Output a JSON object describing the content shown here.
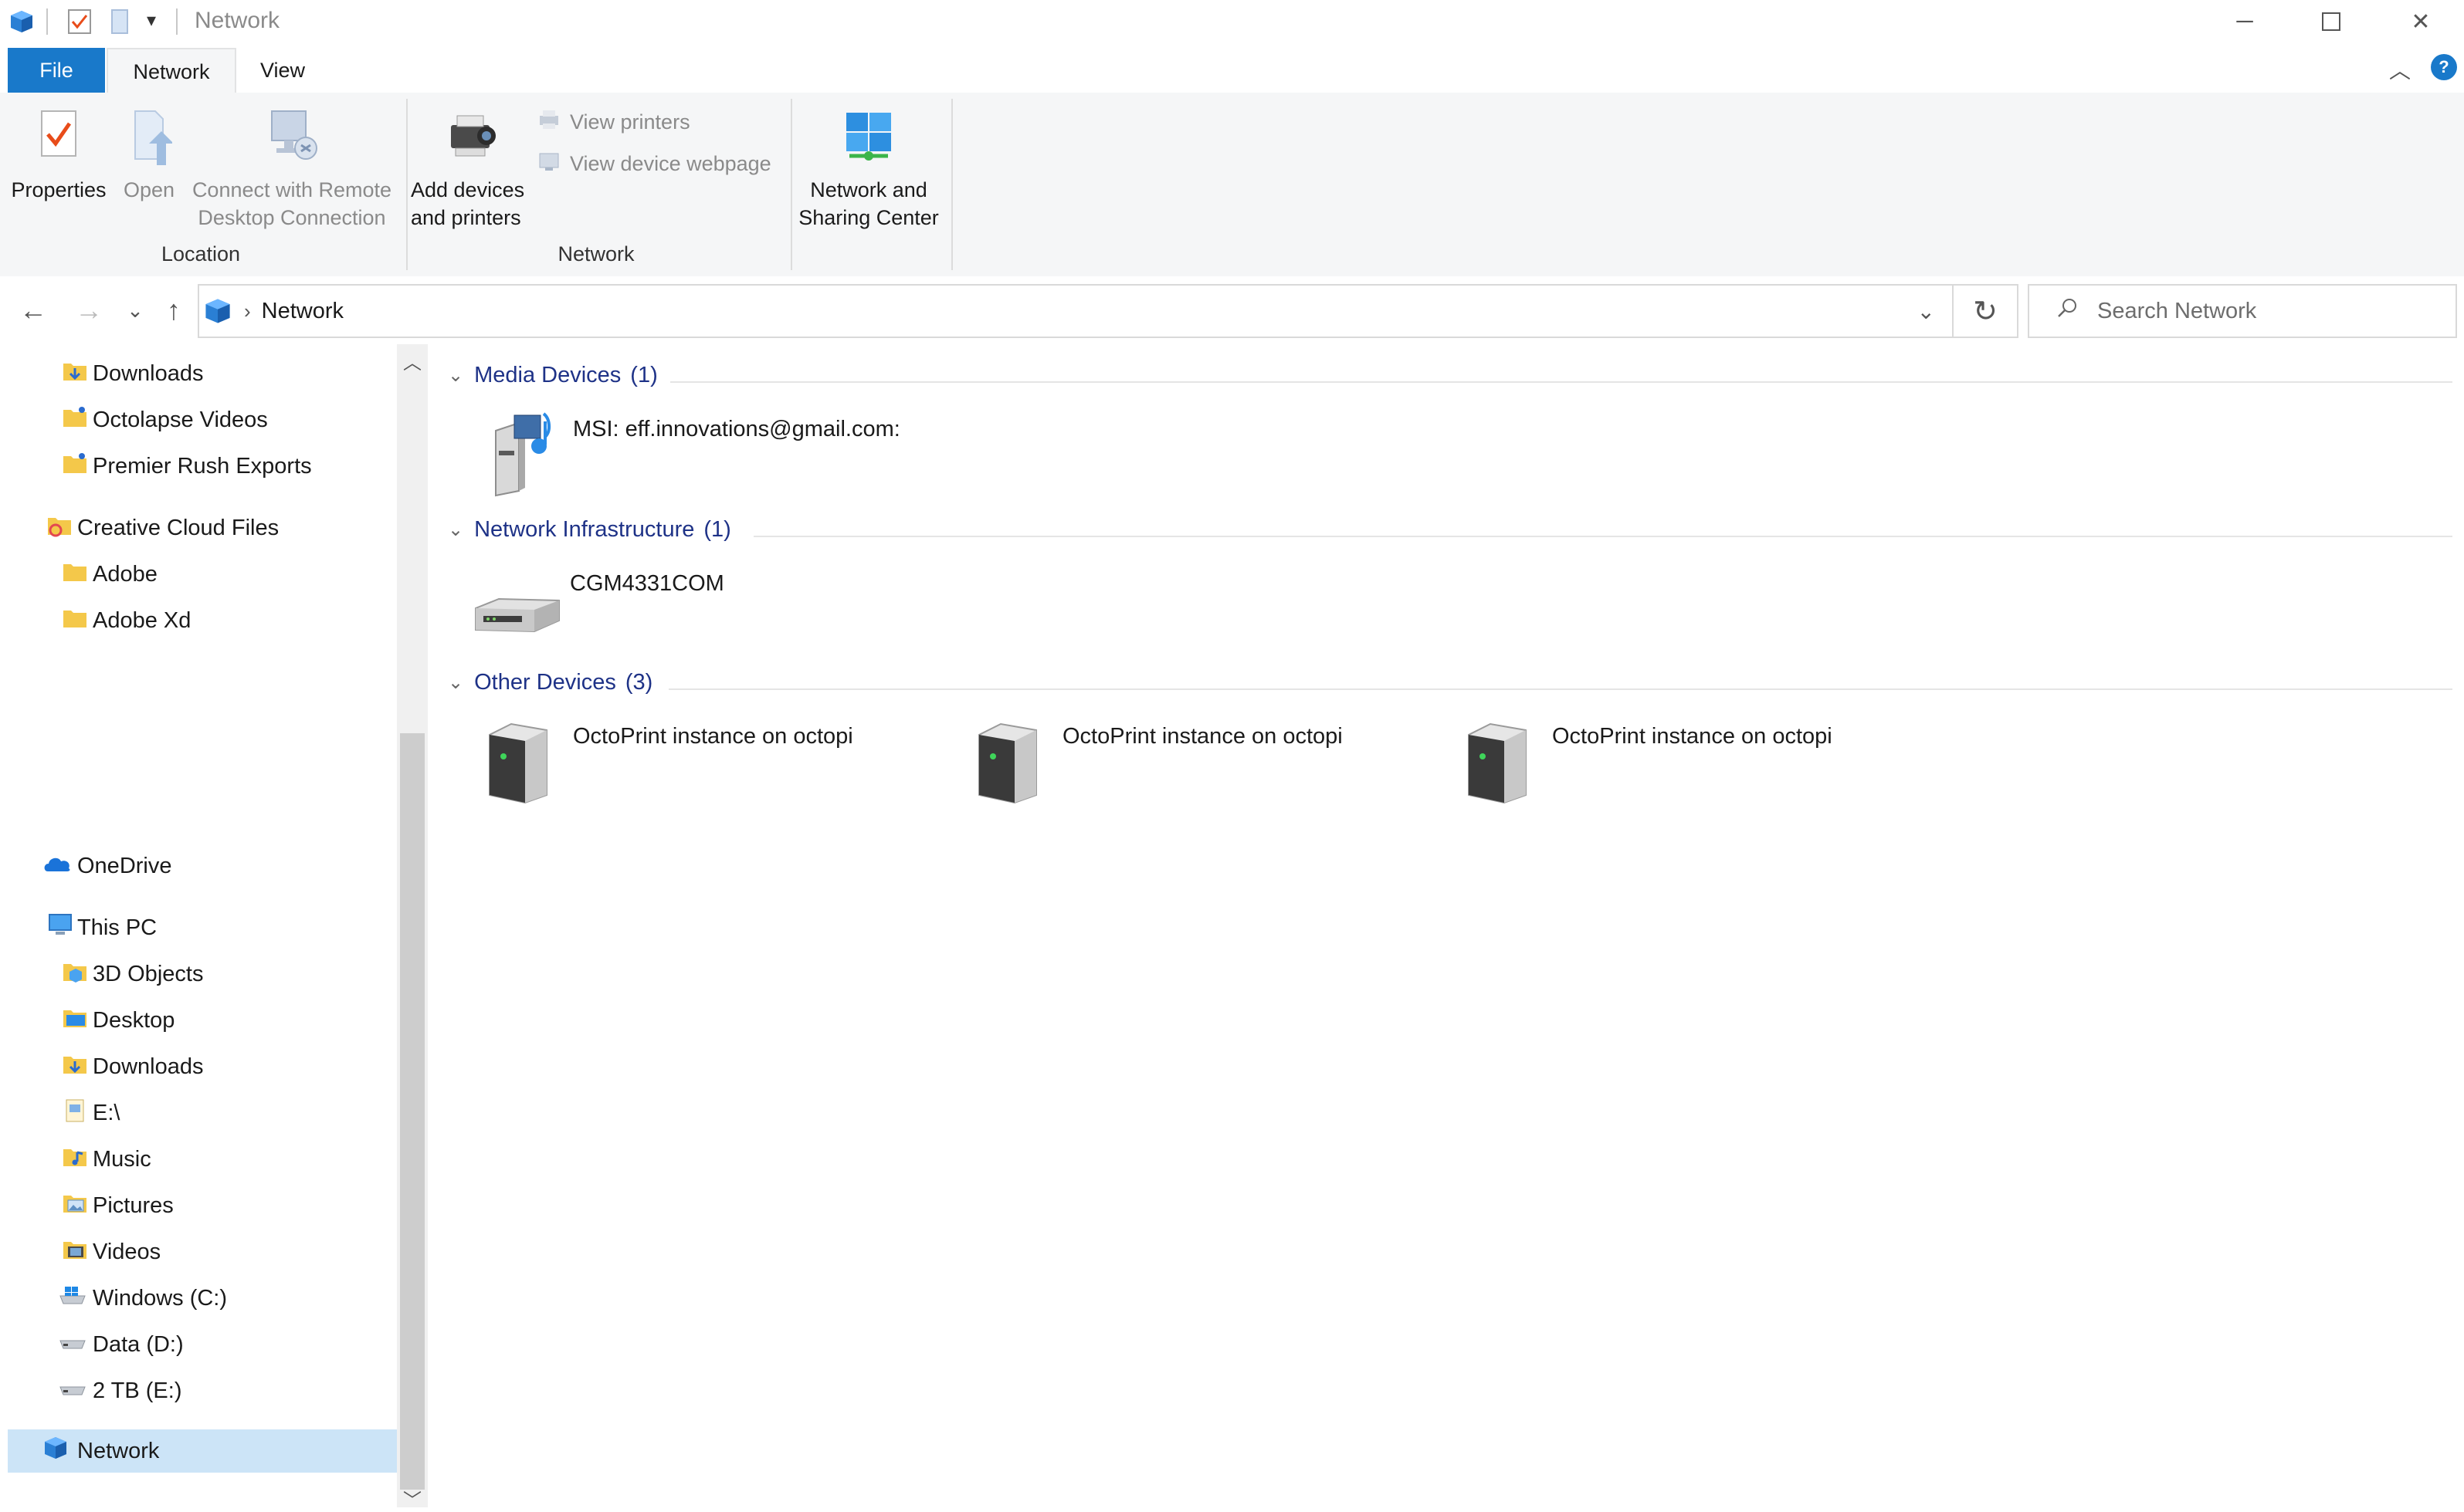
{
  "window": {
    "title": "Network",
    "controls": [
      "minimize",
      "maximize",
      "close"
    ]
  },
  "ribbon": {
    "tabs": [
      {
        "label": "File"
      },
      {
        "label": "Network"
      },
      {
        "label": "View"
      }
    ],
    "location_group": {
      "label": "Location",
      "properties": "Properties",
      "open": "Open",
      "connect_line1": "Connect with Remote",
      "connect_line2": "Desktop Connection"
    },
    "network_group": {
      "label": "Network",
      "add_devices_line1": "Add devices",
      "add_devices_line2": "and printers",
      "view_printers": "View printers",
      "view_device_webpage": "View device webpage"
    },
    "sharing": {
      "line1": "Network and",
      "line2": "Sharing Center"
    }
  },
  "address": {
    "path": "Network",
    "search_placeholder": "Search Network"
  },
  "nav": {
    "items": [
      {
        "label": "Downloads",
        "icon": "folder-download-icon"
      },
      {
        "label": "Octolapse Videos",
        "icon": "folder-icon"
      },
      {
        "label": "Premier Rush Exports",
        "icon": "folder-icon"
      },
      {
        "label": "Creative Cloud Files",
        "icon": "creative-cloud-icon"
      },
      {
        "label": "Adobe",
        "icon": "folder-icon"
      },
      {
        "label": "Adobe Xd",
        "icon": "folder-icon"
      },
      {
        "label": "OneDrive",
        "icon": "onedrive-icon"
      },
      {
        "label": "This PC",
        "icon": "this-pc-icon"
      },
      {
        "label": "3D Objects",
        "icon": "3d-objects-icon"
      },
      {
        "label": "Desktop",
        "icon": "desktop-folder-icon"
      },
      {
        "label": "Downloads",
        "icon": "folder-download-icon"
      },
      {
        "label": "E:\\",
        "icon": "drive-icon"
      },
      {
        "label": "Music",
        "icon": "music-folder-icon"
      },
      {
        "label": "Pictures",
        "icon": "pictures-folder-icon"
      },
      {
        "label": "Videos",
        "icon": "videos-folder-icon"
      },
      {
        "label": "Windows (C:)",
        "icon": "windows-drive-icon"
      },
      {
        "label": "Data (D:)",
        "icon": "drive-icon"
      },
      {
        "label": "2 TB (E:)",
        "icon": "drive-icon"
      },
      {
        "label": "Network",
        "icon": "network-icon"
      }
    ]
  },
  "groups": {
    "media": {
      "label": "Media Devices",
      "count": "(1)",
      "items": [
        {
          "label": "MSI: eff.innovations@gmail.com:"
        }
      ]
    },
    "infrastructure": {
      "label": "Network Infrastructure",
      "count": "(1)",
      "items": [
        {
          "label": "CGM4331COM"
        }
      ]
    },
    "other": {
      "label": "Other Devices",
      "count": "(3)",
      "items": [
        {
          "label": "OctoPrint instance on octopi"
        },
        {
          "label": "OctoPrint instance on octopi"
        },
        {
          "label": "OctoPrint instance on octopi"
        }
      ]
    }
  },
  "colors": {
    "accent": "#1979ca",
    "group_header": "#1e3287",
    "ribbon_bg": "#f5f6f7",
    "selection": "#cce4f7"
  }
}
